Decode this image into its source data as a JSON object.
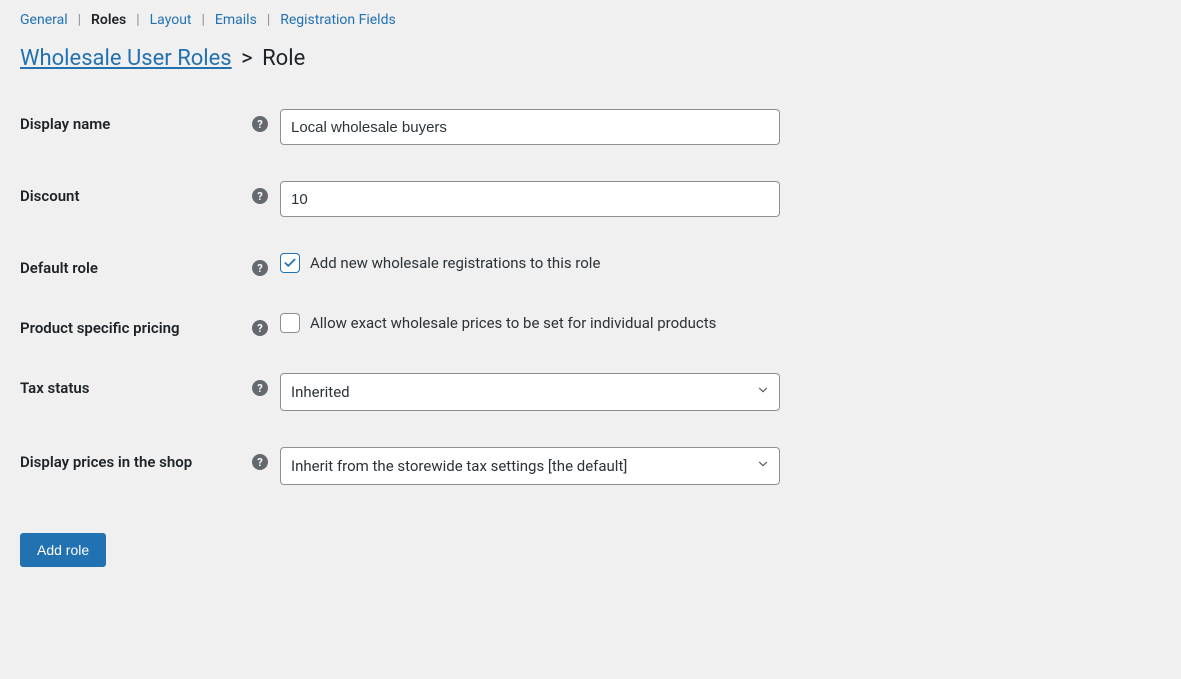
{
  "tabs": {
    "general": "General",
    "roles": "Roles",
    "layout": "Layout",
    "emails": "Emails",
    "registration_fields": "Registration Fields"
  },
  "breadcrumb": {
    "parent": "Wholesale User Roles",
    "separator": ">",
    "current": "Role"
  },
  "form": {
    "display_name": {
      "label": "Display name",
      "value": "Local wholesale buyers"
    },
    "discount": {
      "label": "Discount",
      "value": "10"
    },
    "default_role": {
      "label": "Default role",
      "checkbox_label": "Add new wholesale registrations to this role",
      "checked": true
    },
    "product_specific_pricing": {
      "label": "Product specific pricing",
      "checkbox_label": "Allow exact wholesale prices to be set for individual products",
      "checked": false
    },
    "tax_status": {
      "label": "Tax status",
      "value": "Inherited"
    },
    "display_prices": {
      "label": "Display prices in the shop",
      "value": "Inherit from the storewide tax settings [the default]"
    }
  },
  "submit": {
    "label": "Add role"
  }
}
